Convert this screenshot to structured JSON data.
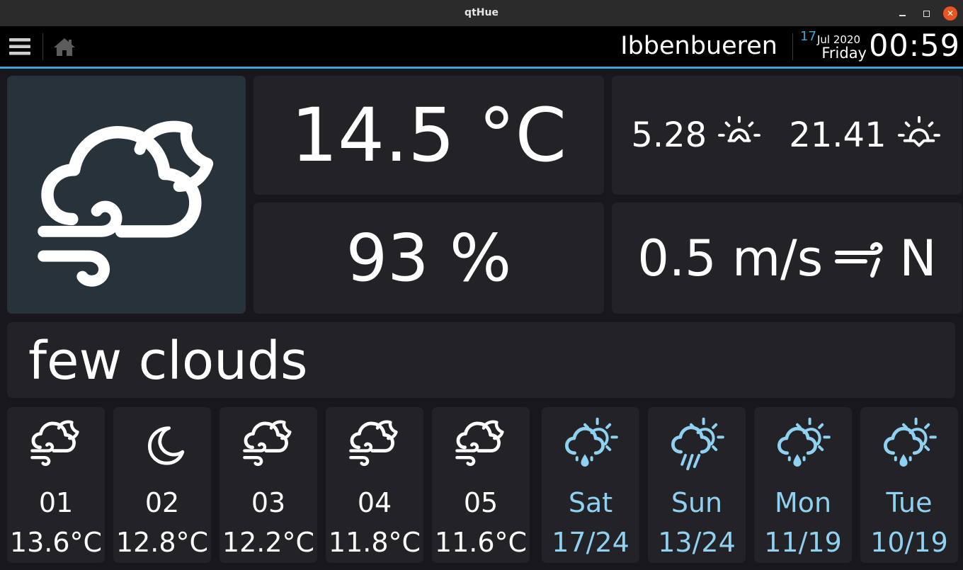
{
  "window": {
    "title": "qtHue"
  },
  "header": {
    "city": "Ibbenbueren",
    "date_day": "17",
    "date_month_year": "Jul 2020",
    "date_weekday": "Friday",
    "time": "00:59"
  },
  "current": {
    "icon": "wind-cloud-moon-icon",
    "temperature": "14.5 °C",
    "humidity": "93 %",
    "sunrise": "5.28",
    "sunset": "21.41",
    "wind_speed": "0.5 m/s",
    "wind_direction": "N",
    "description": "few clouds"
  },
  "colors": {
    "accent": "#3fa4cf",
    "forecast_day": "#8ed1f0",
    "tile_bg": "#222227",
    "icon_tile_bg": "#28323a"
  },
  "forecast": [
    {
      "label": "01",
      "value": "13.6°C",
      "icon": "wind-cloud-moon-icon"
    },
    {
      "label": "02",
      "value": "12.8°C",
      "icon": "moon-icon"
    },
    {
      "label": "03",
      "value": "12.2°C",
      "icon": "wind-cloud-moon-icon"
    },
    {
      "label": "04",
      "value": "11.8°C",
      "icon": "wind-cloud-moon-icon"
    },
    {
      "label": "05",
      "value": "11.6°C",
      "icon": "wind-cloud-moon-icon"
    },
    {
      "label": "Sat",
      "value": "17/24",
      "icon": "sun-cloud-drizzle-icon"
    },
    {
      "label": "Sun",
      "value": "13/24",
      "icon": "sun-cloud-rain-icon"
    },
    {
      "label": "Mon",
      "value": "11/19",
      "icon": "sun-cloud-drizzle-icon"
    },
    {
      "label": "Tue",
      "value": "10/19",
      "icon": "sun-cloud-drizzle-icon"
    }
  ]
}
